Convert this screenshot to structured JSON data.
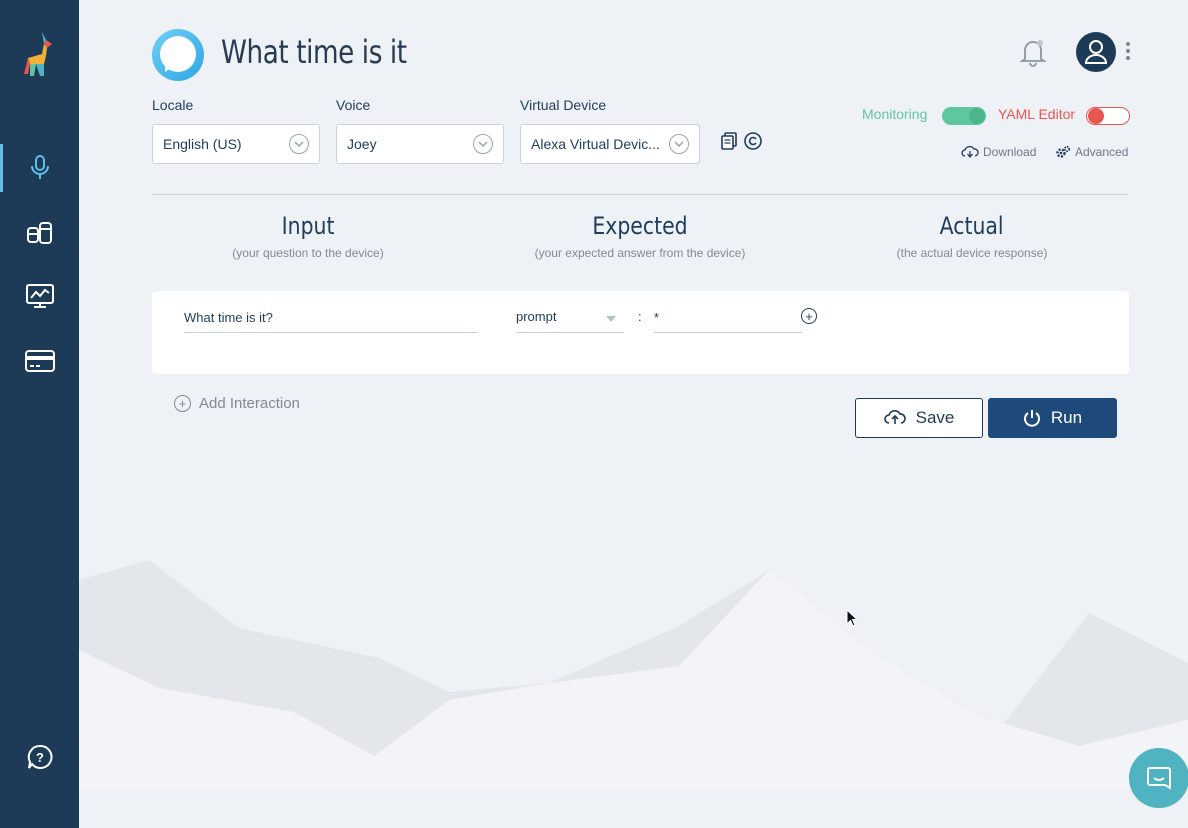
{
  "header": {
    "title": "What time is it"
  },
  "fields": {
    "locale": {
      "label": "Locale",
      "value": "English (US)"
    },
    "voice": {
      "label": "Voice",
      "value": "Joey"
    },
    "device": {
      "label": "Virtual Device",
      "value": "Alexa Virtual Devic..."
    }
  },
  "toggles": {
    "monitoring": {
      "label": "Monitoring",
      "on": true,
      "color": "#5fc7a0"
    },
    "yaml": {
      "label": "YAML Editor",
      "on": false,
      "color": "#e8574f"
    }
  },
  "links": {
    "download": "Download",
    "advanced": "Advanced"
  },
  "columns": [
    {
      "title": "Input",
      "subtitle": "(your question to the device)"
    },
    {
      "title": "Expected",
      "subtitle": "(your expected answer from the device)"
    },
    {
      "title": "Actual",
      "subtitle": "(the actual device response)"
    }
  ],
  "interaction": {
    "input": "What time is it?",
    "expected_type": "prompt",
    "separator": ":",
    "expected_value": "*"
  },
  "actions": {
    "add_interaction": "Add Interaction",
    "save": "Save",
    "run": "Run"
  },
  "colors": {
    "sidebar": "#1d3a57",
    "accent": "#5ec0e8",
    "primary": "#1d4a7a",
    "chat": "#4fb3c1"
  },
  "icons": {
    "sidebar": [
      "microphone-icon",
      "database-icon",
      "monitor-chart-icon",
      "credit-card-icon",
      "help-icon"
    ]
  }
}
